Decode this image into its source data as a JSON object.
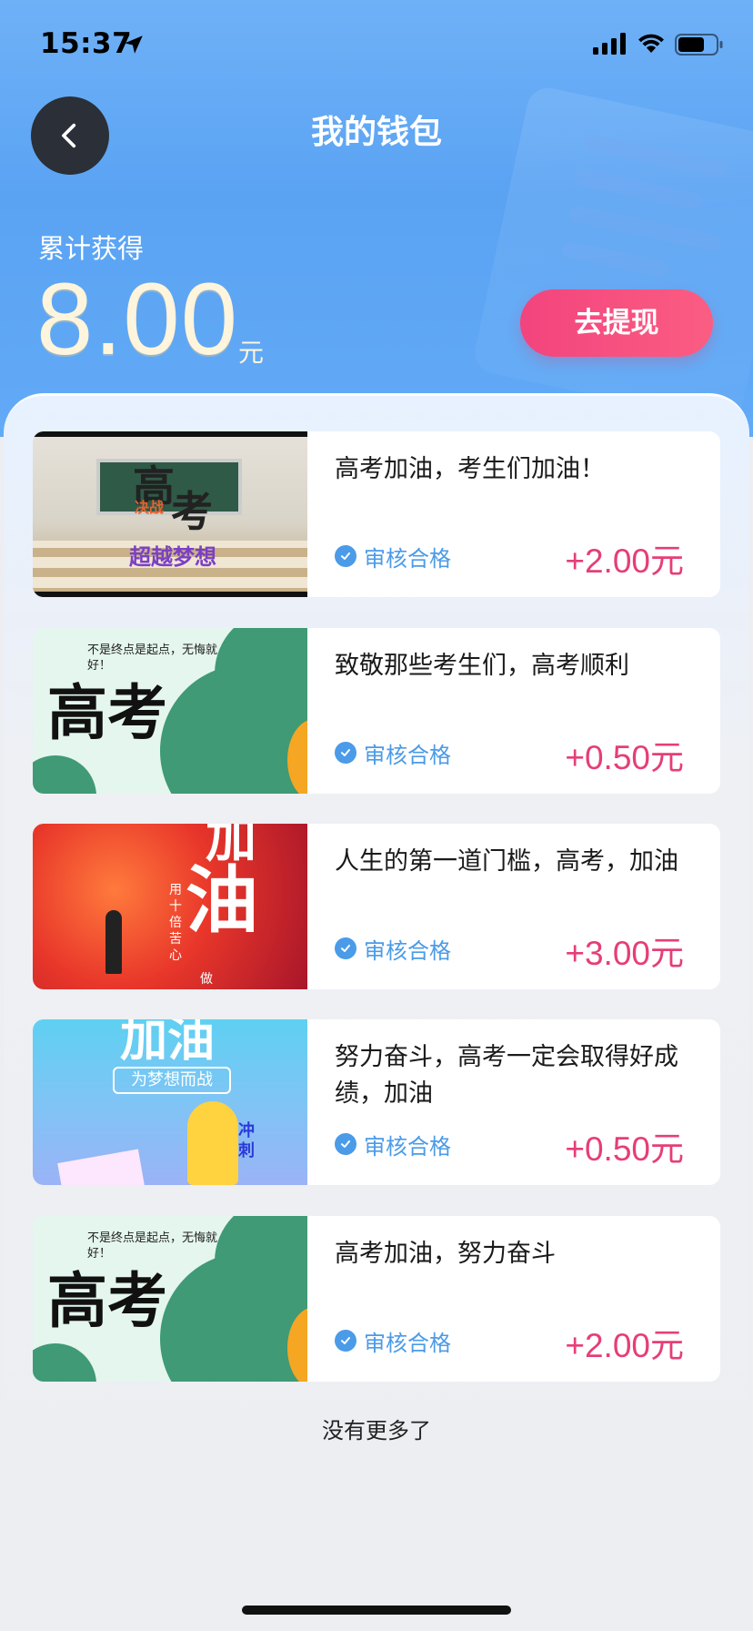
{
  "status_bar": {
    "time": "15:37"
  },
  "header": {
    "title": "我的钱包",
    "earned_label": "累计获得",
    "earned_amount": "8.00",
    "earned_unit": "元",
    "withdraw_label": "去提现"
  },
  "thumb_texts": {
    "t1_big1": "高",
    "t1_big2": "考",
    "t1_small": "决战",
    "t1_sub": "超越梦想",
    "t2_big": "高考",
    "t2_poem": "不是终点是起点，无悔就好！",
    "t3_big": "油",
    "t3_top": "加",
    "t3_side": "用十倍苦心",
    "t3_side2": "做",
    "t4_big": "加油",
    "t4_banner": "为梦想而战",
    "t4_side": "冲刺"
  },
  "items": [
    {
      "title": "高考加油，考生们加油！",
      "status": "审核合格",
      "reward": "+2.00元"
    },
    {
      "title": "致敬那些考生们，高考顺利",
      "status": "审核合格",
      "reward": "+0.50元"
    },
    {
      "title": "人生的第一道门槛，高考，加油",
      "status": "审核合格",
      "reward": "+3.00元"
    },
    {
      "title": "努力奋斗，高考一定会取得好成绩，加油",
      "status": "审核合格",
      "reward": "+0.50元"
    },
    {
      "title": "高考加油，努力奋斗",
      "status": "审核合格",
      "reward": "+2.00元"
    }
  ],
  "footer": {
    "end_text": "没有更多了"
  },
  "colors": {
    "accent": "#4b9be8",
    "reward": "#e63e77",
    "withdraw": "#f2447e",
    "header": "#5aa3f3"
  }
}
